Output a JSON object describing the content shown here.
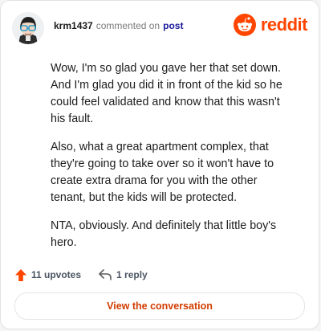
{
  "header": {
    "username": "krm1437",
    "action_text": "commented on",
    "post_link": "post",
    "brand_word": "reddit"
  },
  "comment": {
    "paragraphs": [
      "Wow, I'm so glad you gave her that set down. And I'm glad you did it in front of the kid so he could feel validated and know that this wasn't his fault.",
      "Also, what a great apartment complex, that they're going to take over so it won't have to create extra drama for you with the other tenant, but the kids will be protected.",
      "NTA, obviously. And definitely that little boy's hero."
    ]
  },
  "footer": {
    "upvotes": "11 upvotes",
    "replies": "1 reply"
  },
  "cta": {
    "label": "View the conversation"
  },
  "colors": {
    "brand": "#ff4500",
    "cta_text": "#d23c00",
    "upvote_icon": "#ff4500"
  },
  "icons": {
    "upvote": "upvote-arrow-icon",
    "reply": "reply-arrow-icon",
    "logo": "reddit-logo-icon"
  }
}
